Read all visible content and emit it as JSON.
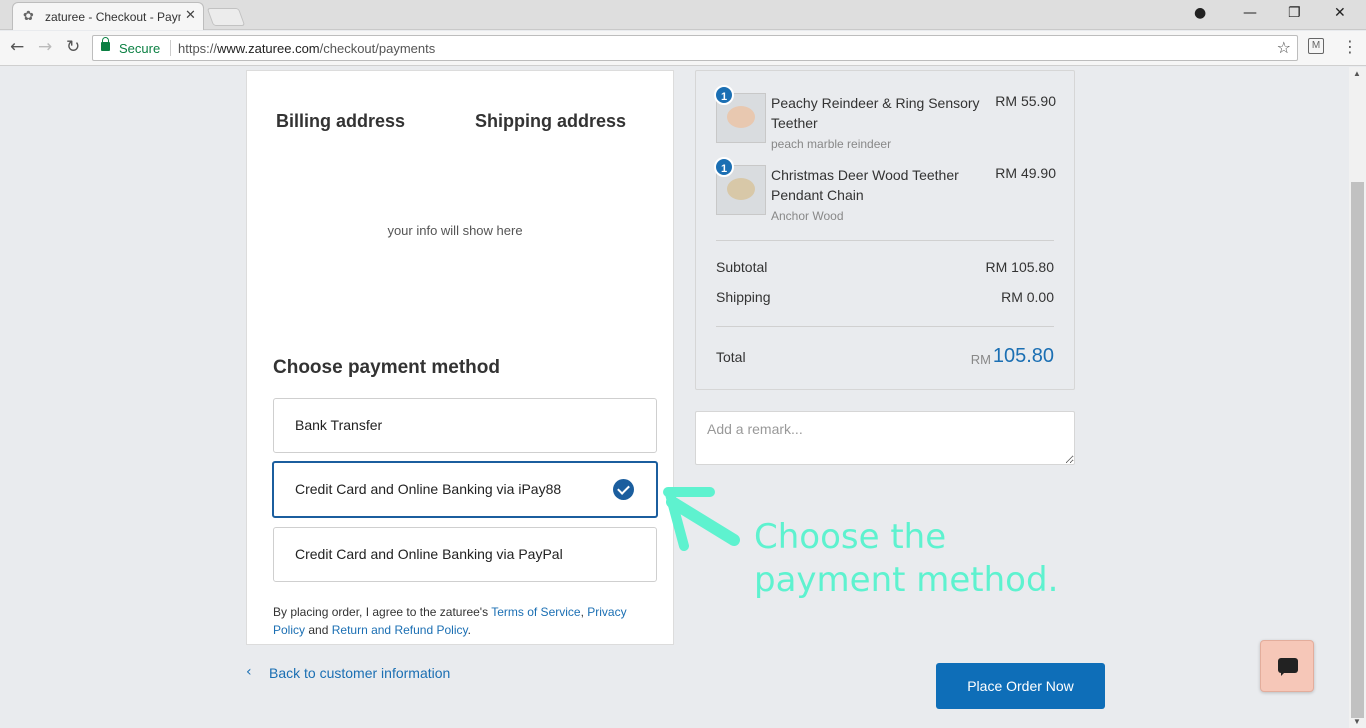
{
  "browser": {
    "tab_title": "zaturee - Checkout - Payments",
    "tab_close": "✕",
    "secure_label": "Secure",
    "url_scheme": "https://",
    "url_host": "www.zaturee.com",
    "url_path": "/checkout/payments"
  },
  "addresses": {
    "billing_title": "Billing address",
    "shipping_title": "Shipping address",
    "placeholder": "your info will show here"
  },
  "payment": {
    "title": "Choose payment method",
    "options": [
      {
        "label": "Bank Transfer",
        "selected": false
      },
      {
        "label": "Credit Card and Online Banking via iPay88",
        "selected": true
      },
      {
        "label": "Credit Card and Online Banking via PayPal",
        "selected": false
      }
    ]
  },
  "terms": {
    "prefix": "By placing order, I agree to the zaturee's",
    "tos": "Terms of Service",
    "comma": ",",
    "privacy": "Privacy Policy",
    "and": "and",
    "refund": "Return and Refund Policy",
    "period": "."
  },
  "back_link": "Back to customer information",
  "order": {
    "items": [
      {
        "qty": "1",
        "name": "Peachy Reindeer & Ring Sensory Teether",
        "variant": "peach marble reindeer",
        "price": "RM 55.90"
      },
      {
        "qty": "1",
        "name": "Christmas Deer Wood Teether Pendant Chain",
        "variant": "Anchor Wood",
        "price": "RM 49.90"
      }
    ],
    "subtotal_label": "Subtotal",
    "subtotal_value": "RM 105.80",
    "shipping_label": "Shipping",
    "shipping_value": "RM 0.00",
    "total_label": "Total",
    "total_currency": "RM",
    "total_value": "105.80"
  },
  "remark_placeholder": "Add a remark...",
  "place_order_label": "Place Order Now",
  "annotation": "Choose the payment method.",
  "colors": {
    "accent": "#1b6fb3",
    "button": "#0e6eb8",
    "annotation": "#5ef2cf",
    "chat": "#f6c7b8"
  }
}
